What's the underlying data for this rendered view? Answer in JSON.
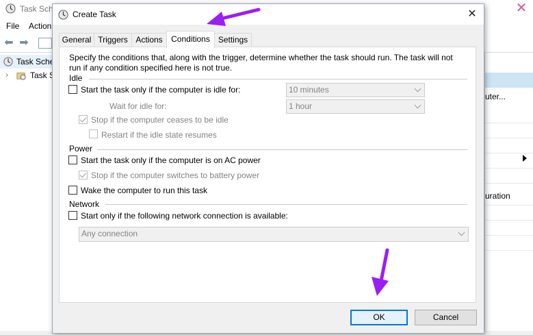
{
  "background_window": {
    "title": "Task Sche",
    "menu": [
      "File",
      "Action"
    ],
    "tree": [
      "Task Sche",
      "Task S"
    ],
    "right_panel": [
      "uter...",
      "uration"
    ]
  },
  "dialog": {
    "title": "Create Task",
    "close_glyph": "✕",
    "tabs": [
      "General",
      "Triggers",
      "Actions",
      "Conditions",
      "Settings"
    ],
    "active_tab": "Conditions",
    "description": [
      "Specify the conditions that, along with the trigger, determine whether the task should run.  The task will not",
      "run  if any condition specified here is not true."
    ],
    "idle": {
      "group_label": "Idle",
      "start_if_idle": {
        "label": "Start the task only if the computer is idle for:",
        "checked": false
      },
      "idle_for_value": "10 minutes",
      "wait_for_idle_label": "Wait for idle for:",
      "wait_value": "1 hour",
      "stop_if_not_idle": {
        "label": "Stop if the computer ceases to be idle",
        "checked": true
      },
      "restart_if_idle": {
        "label": "Restart if the idle state resumes",
        "checked": false
      }
    },
    "power": {
      "group_label": "Power",
      "ac_power": {
        "label": "Start the task only if the computer is on AC power",
        "checked": false
      },
      "stop_on_battery": {
        "label": "Stop if the computer switches to battery power",
        "checked": true
      },
      "wake": {
        "label": "Wake the computer to run this task",
        "checked": false
      }
    },
    "network": {
      "group_label": "Network",
      "start_if_network": {
        "label": "Start only if the following network connection is available:",
        "checked": false
      },
      "connection_value": "Any connection"
    },
    "buttons": {
      "ok": "OK",
      "cancel": "Cancel"
    }
  },
  "colors": {
    "annotation_arrow": "#9b1ff0",
    "accent": "#0078d7"
  }
}
